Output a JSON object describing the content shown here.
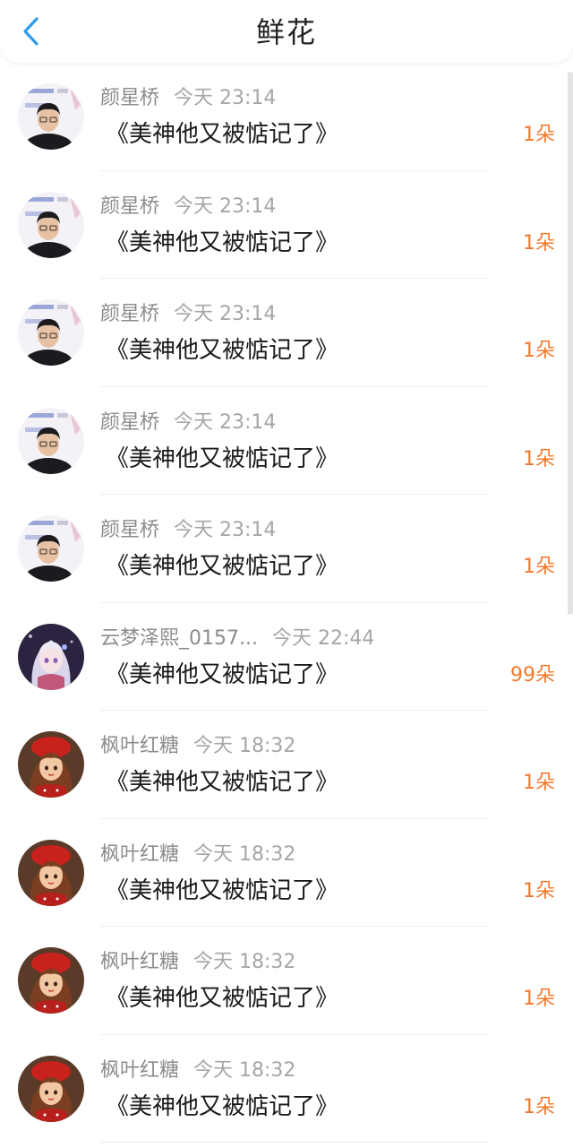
{
  "header": {
    "title": "鲜花",
    "back_icon": "chevron-left-icon",
    "accent_color": "#2f9bf0"
  },
  "colors": {
    "count": "#f07a2e",
    "username": "#8c8c8c"
  },
  "rows": [
    {
      "user": "颜星桥",
      "time": "今天 23:14",
      "book": "《美神他又被惦记了》",
      "count": "1朵",
      "avatar": "avatar-boy"
    },
    {
      "user": "颜星桥",
      "time": "今天 23:14",
      "book": "《美神他又被惦记了》",
      "count": "1朵",
      "avatar": "avatar-boy"
    },
    {
      "user": "颜星桥",
      "time": "今天 23:14",
      "book": "《美神他又被惦记了》",
      "count": "1朵",
      "avatar": "avatar-boy"
    },
    {
      "user": "颜星桥",
      "time": "今天 23:14",
      "book": "《美神他又被惦记了》",
      "count": "1朵",
      "avatar": "avatar-boy"
    },
    {
      "user": "颜星桥",
      "time": "今天 23:14",
      "book": "《美神他又被惦记了》",
      "count": "1朵",
      "avatar": "avatar-boy"
    },
    {
      "user": "云梦泽熙_0157...",
      "time": "今天 22:44",
      "book": "《美神他又被惦记了》",
      "count": "99朵",
      "avatar": "avatar-anime"
    },
    {
      "user": "枫叶红糖",
      "time": "今天 18:32",
      "book": "《美神他又被惦记了》",
      "count": "1朵",
      "avatar": "avatar-girl"
    },
    {
      "user": "枫叶红糖",
      "time": "今天 18:32",
      "book": "《美神他又被惦记了》",
      "count": "1朵",
      "avatar": "avatar-girl"
    },
    {
      "user": "枫叶红糖",
      "time": "今天 18:32",
      "book": "《美神他又被惦记了》",
      "count": "1朵",
      "avatar": "avatar-girl"
    },
    {
      "user": "枫叶红糖",
      "time": "今天 18:32",
      "book": "《美神他又被惦记了》",
      "count": "1朵",
      "avatar": "avatar-girl"
    }
  ]
}
